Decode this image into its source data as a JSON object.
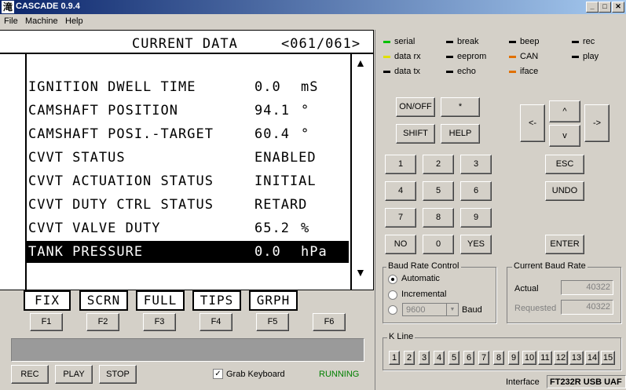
{
  "window": {
    "title": "CASCADE 0.9.4",
    "icon_glyph": "滝",
    "min": "_",
    "max": "□",
    "close": "✕"
  },
  "menu": [
    "File",
    "Machine",
    "Help"
  ],
  "screen": {
    "header_title": "CURRENT DATA",
    "header_page": "<061/061>",
    "rows": [
      {
        "label": "IGNITION DWELL TIME",
        "value": "0.0",
        "unit": "mS"
      },
      {
        "label": "CAMSHAFT POSITION",
        "value": "94.1",
        "unit": "°"
      },
      {
        "label": "CAMSHAFT POSI.-TARGET",
        "value": "60.4",
        "unit": "°"
      },
      {
        "label": "CVVT STATUS",
        "value": "ENABLED",
        "unit": ""
      },
      {
        "label": "CVVT ACTUATION STATUS",
        "value": "INITIAL",
        "unit": ""
      },
      {
        "label": "CVVT DUTY CTRL STATUS",
        "value": "RETARD",
        "unit": ""
      },
      {
        "label": "CVVT VALVE DUTY",
        "value": "65.2",
        "unit": "%"
      },
      {
        "label": "TANK PRESSURE",
        "value": "0.0",
        "unit": "hPa"
      }
    ],
    "scroll_up": "▲",
    "scroll_down": "▼"
  },
  "soft_labels": [
    "FIX",
    "SCRN",
    "FULL",
    "TIPS",
    "GRPH"
  ],
  "fbuttons": [
    "F1",
    "F2",
    "F3",
    "F4",
    "F5",
    "F6"
  ],
  "bottom": {
    "rec": "REC",
    "play": "PLAY",
    "stop": "STOP",
    "grab_keyboard": "Grab Keyboard",
    "status": "RUNNING"
  },
  "leds": [
    {
      "label": "serial",
      "color": "#00c000"
    },
    {
      "label": "break",
      "color": "#000000"
    },
    {
      "label": "beep",
      "color": "#000000"
    },
    {
      "label": "rec",
      "color": "#000000"
    },
    {
      "label": "data rx",
      "color": "#e0e000"
    },
    {
      "label": "eeprom",
      "color": "#000000"
    },
    {
      "label": "CAN",
      "color": "#e07000"
    },
    {
      "label": "play",
      "color": "#000000"
    },
    {
      "label": "data tx",
      "color": "#000000"
    },
    {
      "label": "echo",
      "color": "#000000"
    },
    {
      "label": "iface",
      "color": "#e07000"
    }
  ],
  "keypad": {
    "onoff": "ON/OFF",
    "star": "*",
    "shift": "SHIFT",
    "help": "HELP",
    "up": "^",
    "left": "<-",
    "right": "->",
    "down": "v",
    "digits": [
      "1",
      "2",
      "3",
      "4",
      "5",
      "6",
      "7",
      "8",
      "9",
      "NO",
      "0",
      "YES"
    ],
    "esc": "ESC",
    "undo": "UNDO",
    "enter": "ENTER"
  },
  "baud_control": {
    "title": "Baud Rate Control",
    "automatic": "Automatic",
    "incremental": "Incremental",
    "selected_rate": "9600",
    "baud_label": "Baud",
    "dropdown_arrow": "▼"
  },
  "current_baud": {
    "title": "Current Baud Rate",
    "actual_label": "Actual",
    "actual_value": "40322",
    "requested_label": "Requested",
    "requested_value": "40322"
  },
  "kline": {
    "title": "K Line",
    "numbers": [
      "1",
      "2",
      "3",
      "4",
      "5",
      "6",
      "7",
      "8",
      "9",
      "10",
      "11",
      "12",
      "13",
      "14",
      "15"
    ]
  },
  "interface": {
    "label": "Interface",
    "value": "FT232R USB UAF"
  }
}
